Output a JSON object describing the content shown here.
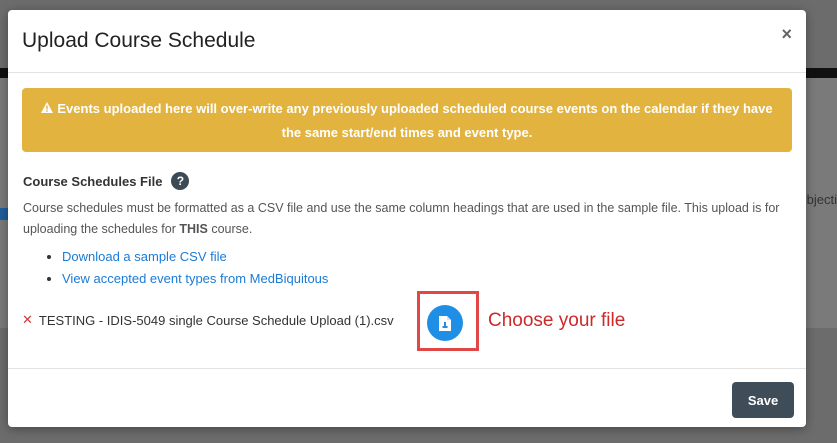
{
  "modal": {
    "title": "Upload Course Schedule",
    "close_symbol": "×",
    "alert_text": "Events uploaded here will over-write any previously uploaded scheduled course events on the calendar if they have the same start/end times and event type.",
    "section_title": "Course Schedules File",
    "help_symbol": "?",
    "description_part1": "Course schedules must be formatted as a CSV file and use the same column headings that are used in the sample file. This upload is for uploading the schedules for ",
    "description_bold": "THIS",
    "description_part2": " course.",
    "links": [
      {
        "label": "Download a sample CSV file"
      },
      {
        "label": "View accepted event types from MedBiquitous"
      }
    ],
    "file": {
      "remove_symbol": "✕",
      "name": "TESTING - IDIS-5049 single Course Schedule Upload (1).csv"
    },
    "annotation": "Choose your file",
    "save_label": "Save"
  },
  "background": {
    "edge_text": "bjecti"
  },
  "colors": {
    "alert": "#e2b33f",
    "link": "#1b7bd6",
    "file_button": "#1f8fe5",
    "save_button": "#3f4d58",
    "annotation": "#cc2a2a"
  },
  "icons": [
    "close-icon",
    "warning-icon",
    "help-icon",
    "remove-icon",
    "file-icon"
  ]
}
